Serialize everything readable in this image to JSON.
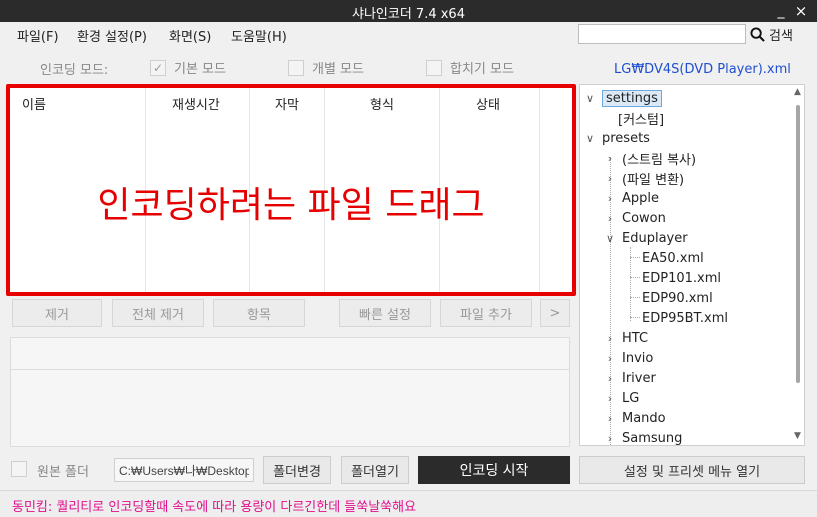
{
  "window": {
    "title": "샤나인코더  7.4  x64",
    "minimize_glyph": "_",
    "close_glyph": "×"
  },
  "menu": [
    "파일(F)",
    "환경 설정(P)",
    "화면(S)",
    "도움말(H)"
  ],
  "search": {
    "button_label": "검색",
    "icon": "search-icon",
    "value": ""
  },
  "encoding_mode": {
    "label": "인코딩 모드:",
    "options": [
      {
        "label": "기본 모드",
        "checked": true
      },
      {
        "label": "개별 모드",
        "checked": false
      },
      {
        "label": "합치기 모드",
        "checked": false
      }
    ]
  },
  "preset_file": "LG₩DV4S(DVD Player).xml",
  "file_list": {
    "columns": [
      "이름",
      "재생시간",
      "자막",
      "형식",
      "상태"
    ],
    "drop_hint": "인코딩하려는 파일 드래그"
  },
  "action_buttons": [
    "제거",
    "전체 제거",
    "항목",
    "빠른 설정",
    "파일 추가",
    ">"
  ],
  "tree": {
    "settings": "settings",
    "custom": "[커스텀]",
    "presets": "presets",
    "stream_copy": "(스트림 복사)",
    "file_convert": "(파일 변환)",
    "apple": "Apple",
    "cowon": "Cowon",
    "eduplayer": "Eduplayer",
    "ea50": "EA50.xml",
    "edp101": "EDP101.xml",
    "edp90": "EDP90.xml",
    "edp95bt": "EDP95BT.xml",
    "htc": "HTC",
    "invio": "Invio",
    "iriver": "Iriver",
    "lg": "LG",
    "mando": "Mando",
    "samsung": "Samsung"
  },
  "bottom": {
    "source_folder_label": "원본 폴더",
    "source_folder_checked": false,
    "path": "C:₩Users₩나₩Desktop",
    "change_folder": "폴더변경",
    "open_folder": "폴더열기",
    "start_encoding": "인코딩 시작",
    "open_settings_menu": "설정 및 프리셋 메뉴 열기"
  },
  "status_message": "동민킴: 퀄리티로 인코딩할때 속도에 따라 용량이 다르긴한데 들쑥날쑥해요",
  "colors": {
    "accent_red": "#e60000",
    "link_blue": "#1f4fd1",
    "status_magenta": "#e0118c",
    "titlebar": "#2b2b2b"
  }
}
